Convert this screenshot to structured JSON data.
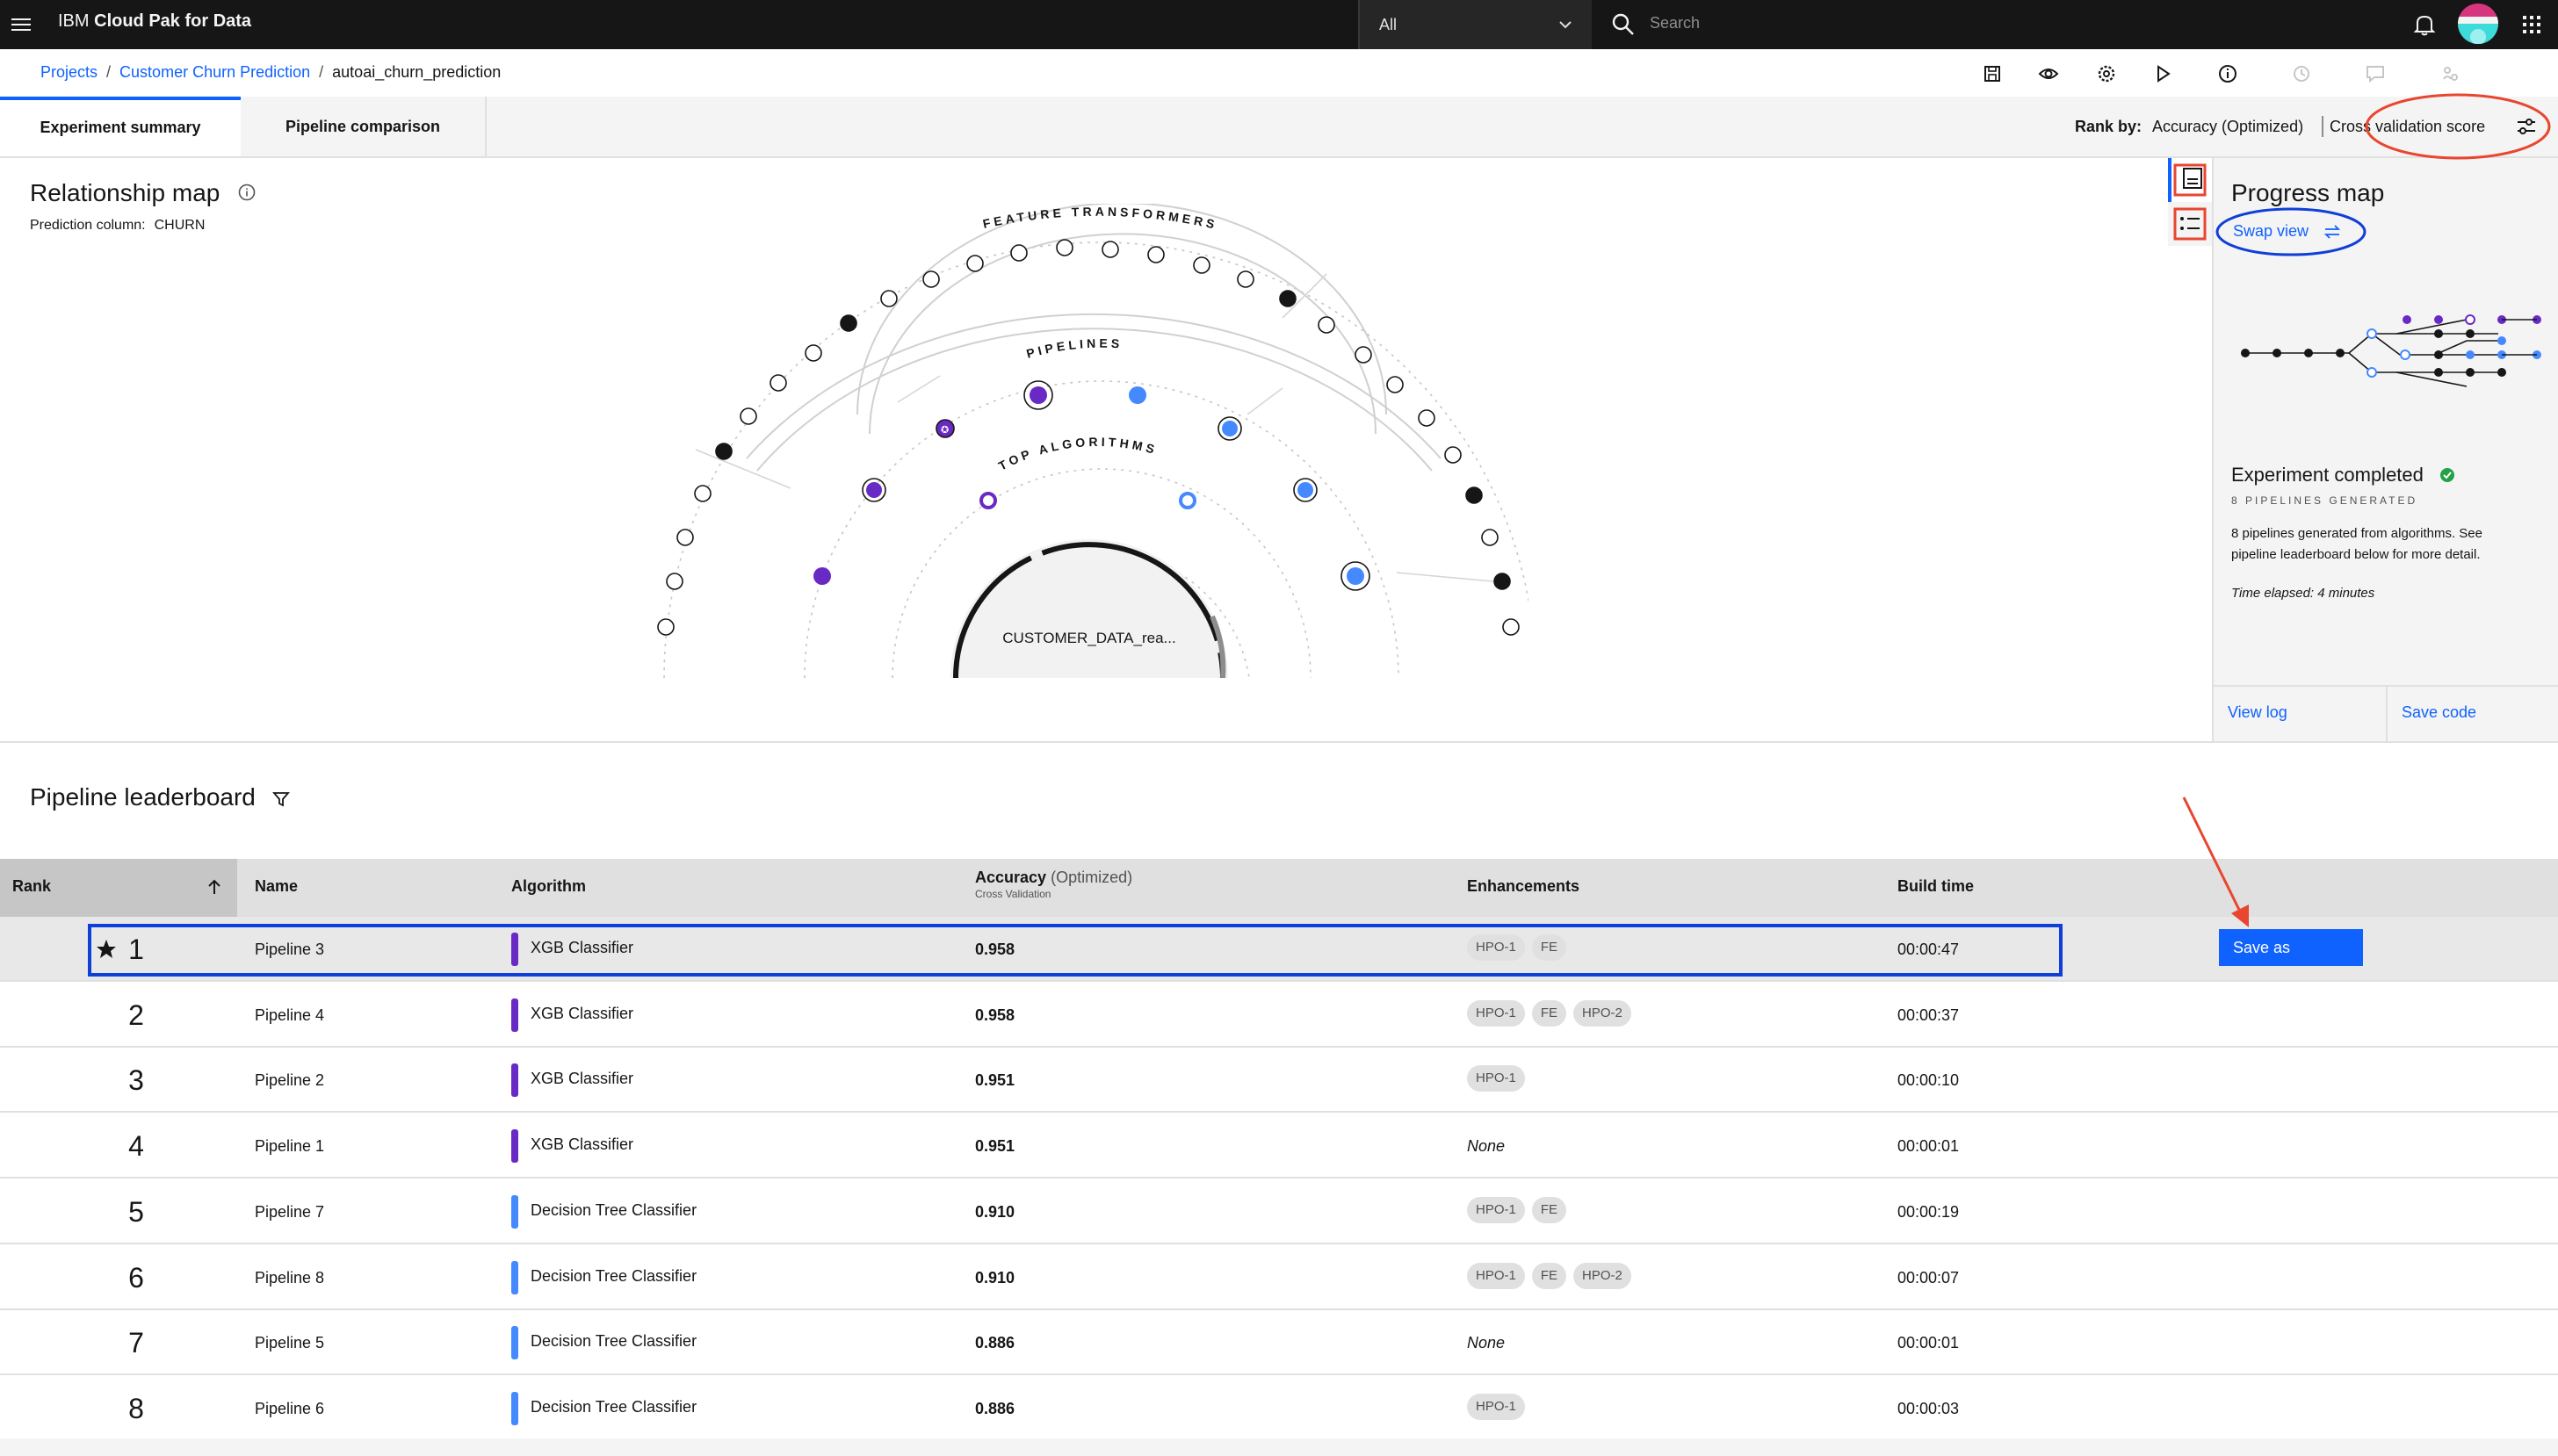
{
  "header": {
    "brand_prefix": "IBM",
    "brand_name": "Cloud Pak for Data",
    "scope_value": "All",
    "search_placeholder": "Search"
  },
  "breadcrumb": {
    "items": [
      "Projects",
      "Customer Churn Prediction",
      "autoai_churn_prediction"
    ],
    "separator": "/"
  },
  "tabs": {
    "experiment_summary": "Experiment summary",
    "pipeline_comparison": "Pipeline comparison"
  },
  "rank_by": {
    "label": "Rank by:",
    "metric": "Accuracy (Optimized)",
    "secondary": "Cross validation score"
  },
  "relationship_map": {
    "title": "Relationship map",
    "prediction_label": "Prediction column:",
    "prediction_value": "CHURN",
    "ring_labels": [
      "FEATURE TRANSFORMERS",
      "PIPELINES",
      "TOP ALGORITHMS"
    ],
    "center_label": "CUSTOMER_DATA_rea..."
  },
  "progress_map": {
    "title": "Progress map",
    "swap_view": "Swap view",
    "status": "Experiment completed",
    "pipelines_generated": "8 PIPELINES GENERATED",
    "description": "8 pipelines generated from algorithms. See pipeline leaderboard below for more detail.",
    "elapsed": "Time elapsed: 4 minutes",
    "view_log": "View log",
    "save_code": "Save code"
  },
  "leaderboard": {
    "title": "Pipeline leaderboard",
    "columns": {
      "rank": "Rank",
      "name": "Name",
      "algorithm": "Algorithm",
      "accuracy": "Accuracy",
      "accuracy_opt": "(Optimized)",
      "accuracy_sub": "Cross Validation",
      "enhancements": "Enhancements",
      "build_time": "Build time"
    },
    "save_as": "Save as",
    "rows": [
      {
        "rank": "1",
        "name": "Pipeline 3",
        "algorithm": "XGB Classifier",
        "accuracy": "0.958",
        "enhancements": [
          "HPO-1",
          "FE"
        ],
        "build_time": "00:00:47"
      },
      {
        "rank": "2",
        "name": "Pipeline 4",
        "algorithm": "XGB Classifier",
        "accuracy": "0.958",
        "enhancements": [
          "HPO-1",
          "FE",
          "HPO-2"
        ],
        "build_time": "00:00:37"
      },
      {
        "rank": "3",
        "name": "Pipeline 2",
        "algorithm": "XGB Classifier",
        "accuracy": "0.951",
        "enhancements": [
          "HPO-1"
        ],
        "build_time": "00:00:10"
      },
      {
        "rank": "4",
        "name": "Pipeline 1",
        "algorithm": "XGB Classifier",
        "accuracy": "0.951",
        "enhancements_none": "None",
        "build_time": "00:00:01"
      },
      {
        "rank": "5",
        "name": "Pipeline 7",
        "algorithm": "Decision Tree Classifier",
        "accuracy": "0.910",
        "enhancements": [
          "HPO-1",
          "FE"
        ],
        "build_time": "00:00:19"
      },
      {
        "rank": "6",
        "name": "Pipeline 8",
        "algorithm": "Decision Tree Classifier",
        "accuracy": "0.910",
        "enhancements": [
          "HPO-1",
          "FE",
          "HPO-2"
        ],
        "build_time": "00:00:07"
      },
      {
        "rank": "7",
        "name": "Pipeline 5",
        "algorithm": "Decision Tree Classifier",
        "accuracy": "0.886",
        "enhancements_none": "None",
        "build_time": "00:00:01"
      },
      {
        "rank": "8",
        "name": "Pipeline 6",
        "algorithm": "Decision Tree Classifier",
        "accuracy": "0.886",
        "enhancements": [
          "HPO-1"
        ],
        "build_time": "00:00:03"
      }
    ]
  },
  "colors": {
    "accent": "#0f62fe",
    "xgb": "#6929c4",
    "decision_tree": "#4589ff",
    "success": "#24a148",
    "annotation_red": "#e8462f",
    "annotation_blue": "#0f3fd8"
  }
}
